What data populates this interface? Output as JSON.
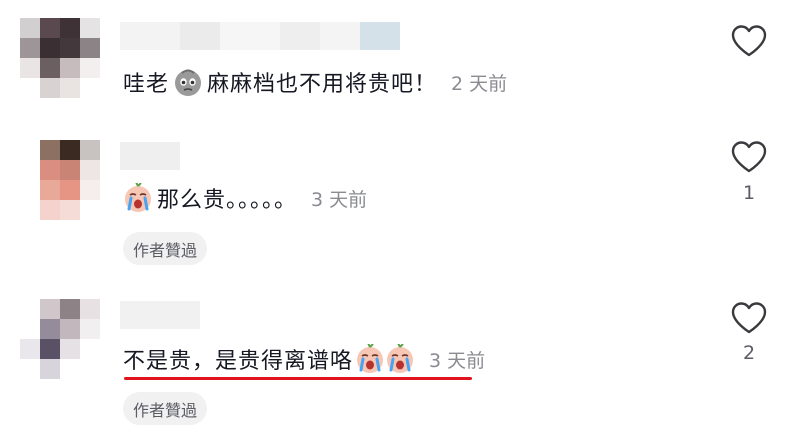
{
  "colors": {
    "text": "#161823",
    "muted": "#8a8b91",
    "chip_bg": "#f1f1f2",
    "highlight_underline": "#e0141c"
  },
  "comments": [
    {
      "text_before_emoji": "哇老",
      "emoji": "pleading-face-emoji",
      "text_after_emoji": "麻麻档也不用将贵吧！",
      "time": "2 天前",
      "like_icon": "heart-outline-icon",
      "like_count": ""
    },
    {
      "emoji": "crying-face-emoji",
      "text": "那么贵。。。。。",
      "time": "3 天前",
      "like_icon": "heart-outline-icon",
      "like_count": "1",
      "author_liked": "作者贊過"
    },
    {
      "text": "不是贵，是贵得离谱咯",
      "emoji": "crying-face-emoji",
      "time": "3 天前",
      "like_icon": "heart-outline-icon",
      "like_count": "2",
      "author_liked": "作者贊過"
    }
  ]
}
